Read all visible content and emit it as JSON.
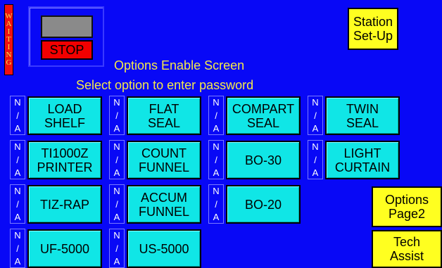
{
  "status": {
    "letters": [
      "W",
      "A",
      "I",
      "T",
      "I",
      "N",
      "G"
    ]
  },
  "controls": {
    "stop_label": "STOP"
  },
  "header": {
    "title": "Options Enable Screen",
    "subtitle": "Select option to enter password"
  },
  "buttons": {
    "station_setup": [
      "Station",
      "Set-Up"
    ],
    "options_page2": [
      "Options",
      "Page2"
    ],
    "tech_assist": [
      "Tech",
      "Assist"
    ]
  },
  "na_marker": [
    "N",
    "/",
    "A"
  ],
  "options": [
    {
      "lines": [
        "LOAD",
        "SHELF"
      ],
      "status": "N/A"
    },
    {
      "lines": [
        "FLAT",
        "SEAL"
      ],
      "status": "N/A"
    },
    {
      "lines": [
        "COMPART",
        "SEAL"
      ],
      "status": "N/A"
    },
    {
      "lines": [
        "TWIN",
        "SEAL"
      ],
      "status": "N/A"
    },
    {
      "lines": [
        "TI1000Z",
        "PRINTER"
      ],
      "status": "N/A"
    },
    {
      "lines": [
        "COUNT",
        "FUNNEL"
      ],
      "status": "N/A"
    },
    {
      "lines": [
        "BO-30"
      ],
      "status": "N/A"
    },
    {
      "lines": [
        "LIGHT",
        "CURTAIN"
      ],
      "status": "N/A"
    },
    {
      "lines": [
        "TIZ-RAP"
      ],
      "status": "N/A"
    },
    {
      "lines": [
        "ACCUM",
        "FUNNEL"
      ],
      "status": "N/A"
    },
    {
      "lines": [
        "BO-20"
      ],
      "status": "N/A"
    },
    {
      "lines": [
        "UF-5000"
      ],
      "status": "N/A"
    },
    {
      "lines": [
        "US-5000"
      ],
      "status": "N/A"
    }
  ],
  "colors": {
    "background": "#0808f6",
    "option_button": "#10e6e6",
    "nav_button": "#ffff20",
    "status_bar": "#f21010",
    "header_text": "#f4e84a"
  }
}
